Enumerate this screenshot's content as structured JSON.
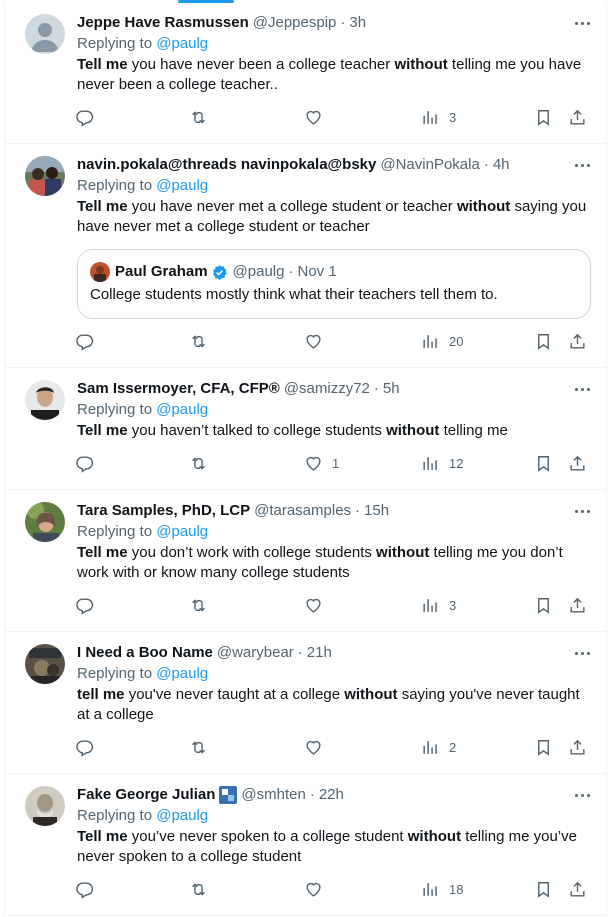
{
  "tweets": [
    {
      "name": "Jeppe Have Rasmussen",
      "handle": "@Jeppespip",
      "time": "3h",
      "replying": "Replying to",
      "replying_to": "@paulg",
      "text_parts": [
        {
          "b": true,
          "t": "Tell me"
        },
        {
          "b": false,
          "t": " you have never been a college teacher "
        },
        {
          "b": true,
          "t": "without"
        },
        {
          "b": false,
          "t": " telling me you have never been a college teacher.."
        }
      ],
      "views": "3",
      "likes": ""
    },
    {
      "name": "navin.pokala@threads navinpokala@bsky",
      "handle": "@NavinPokala",
      "time": "4h",
      "replying": "Replying to",
      "replying_to": "@paulg",
      "text_parts": [
        {
          "b": true,
          "t": "Tell me"
        },
        {
          "b": false,
          "t": " you have never met a college student or teacher "
        },
        {
          "b": true,
          "t": "without"
        },
        {
          "b": false,
          "t": " saying you have never met a college student or teacher"
        }
      ],
      "quote": {
        "name": "Paul Graham",
        "handle": "@paulg",
        "time": "Nov 1",
        "text": "College students mostly think what their teachers tell them to."
      },
      "views": "20",
      "likes": ""
    },
    {
      "name": "Sam Issermoyer, CFA, CFP®",
      "handle": "@samizzy72",
      "time": "5h",
      "replying": "Replying to",
      "replying_to": "@paulg",
      "text_parts": [
        {
          "b": true,
          "t": "Tell me"
        },
        {
          "b": false,
          "t": " you haven’t talked to college students "
        },
        {
          "b": true,
          "t": "without"
        },
        {
          "b": false,
          "t": " telling me"
        }
      ],
      "views": "12",
      "likes": "1"
    },
    {
      "name": "Tara Samples, PhD, LCP",
      "handle": "@tarasamples",
      "time": "15h",
      "replying": "Replying to",
      "replying_to": "@paulg",
      "text_parts": [
        {
          "b": true,
          "t": "Tell me"
        },
        {
          "b": false,
          "t": " you don’t work with college students "
        },
        {
          "b": true,
          "t": "without"
        },
        {
          "b": false,
          "t": " telling me you don’t work with or know many college students"
        }
      ],
      "views": "3",
      "likes": ""
    },
    {
      "name": "I Need a Boo Name",
      "handle": "@warybear",
      "time": "21h",
      "replying": "Replying to",
      "replying_to": "@paulg",
      "text_parts": [
        {
          "b": true,
          "t": "tell me"
        },
        {
          "b": false,
          "t": " you've never taught at a college "
        },
        {
          "b": true,
          "t": "without"
        },
        {
          "b": false,
          "t": " saying you've never taught at a college"
        }
      ],
      "views": "2",
      "likes": ""
    },
    {
      "name": "Fake George Julian",
      "handle": "@smhten",
      "time": "22h",
      "replying": "Replying to",
      "replying_to": "@paulg",
      "text_parts": [
        {
          "b": true,
          "t": "Tell me"
        },
        {
          "b": false,
          "t": " you’ve never spoken to a college student "
        },
        {
          "b": true,
          "t": "without"
        },
        {
          "b": false,
          "t": " telling me you’ve never spoken to a college student"
        }
      ],
      "views": "18",
      "likes": ""
    }
  ],
  "colors": {
    "accent": "#1d9bf0",
    "muted": "#536471",
    "text": "#0f1419",
    "border": "#eff3f4"
  },
  "icons": [
    "reply-icon",
    "retweet-icon",
    "like-icon",
    "views-icon",
    "bookmark-icon",
    "share-icon",
    "more-icon",
    "verified-badge-icon"
  ]
}
